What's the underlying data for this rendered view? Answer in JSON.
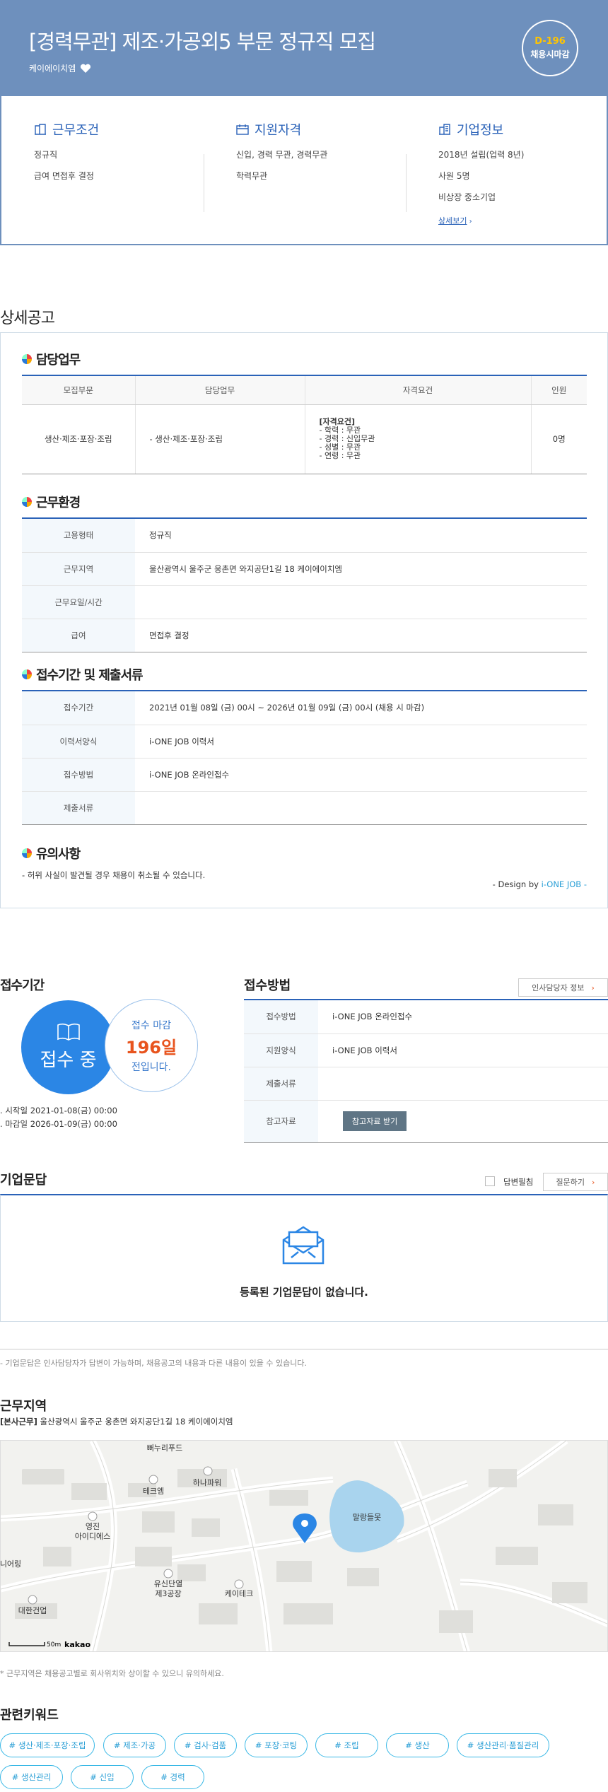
{
  "header": {
    "title": "[경력무관] 제조·가공외5 부문 정규직 모집",
    "company": "케이에이치엠",
    "dday": "D-196",
    "dday_sub": "채용시마감"
  },
  "summary": {
    "work": {
      "title": "근무조건",
      "lines": [
        "정규직",
        "급여 면접후 결정"
      ]
    },
    "qual": {
      "title": "지원자격",
      "lines": [
        "신입, 경력 무관, 경력무관",
        "학력무관"
      ]
    },
    "company": {
      "title": "기업정보",
      "lines": [
        "2018년 설립(업력 8년)",
        "사원 5명",
        "비상장 중소기업"
      ],
      "link": "상세보기"
    }
  },
  "detail": {
    "section_title": "상세공고",
    "duty": {
      "title": "담당업무",
      "headers": [
        "모집부문",
        "담당업무",
        "자격요건",
        "인원"
      ],
      "row": {
        "part": "생산·제조·포장·조립",
        "task": "- 생산·제조·포장·조립",
        "req_title": "[자격요건]",
        "req_lines": [
          "- 학력 : 무관",
          "- 경력 : 신입무관",
          "- 성별 : 무관",
          "- 연령 : 무관"
        ],
        "count": "0명"
      }
    },
    "env": {
      "title": "근무환경",
      "rows": [
        {
          "k": "고용형태",
          "v": "정규직"
        },
        {
          "k": "근무지역",
          "v": "울산광역시 울주군 웅촌면 와지공단1길 18 케이에이치엠"
        },
        {
          "k": "근무요일/시간",
          "v": ""
        },
        {
          "k": "급여",
          "v": "면접후 결정"
        }
      ]
    },
    "period": {
      "title": "접수기간 및 제출서류",
      "rows": [
        {
          "k": "접수기간",
          "v": "2021년 01월 08일 (금) 00시 ~ 2026년 01월 09일 (금) 00시 (채용 시 마감)"
        },
        {
          "k": "이력서양식",
          "v": "i-ONE JOB 이력서"
        },
        {
          "k": "접수방법",
          "v": "i-ONE JOB 온라인접수"
        },
        {
          "k": "제출서류",
          "v": ""
        }
      ]
    },
    "notice": {
      "title": "유의사항",
      "text": "- 허위 사실이 발견될 경우 채용이 취소될 수 있습니다."
    },
    "design_prefix": "- Design by ",
    "design_brand": "i-ONE JOB -"
  },
  "apply": {
    "period_title": "접수기간",
    "status": "접수 중",
    "deadline_label": "접수 마감",
    "days": "196일",
    "days_suffix": "전입니다.",
    "start": "시작일 2021-01-08(금) 00:00",
    "end": "마감일 2026-01-09(금) 00:00",
    "method_title": "접수방법",
    "hr_button": "인사담당자 정보",
    "rows": [
      {
        "k": "접수방법",
        "v": "i-ONE JOB 온라인접수"
      },
      {
        "k": "지원양식",
        "v": "i-ONE JOB 이력서"
      },
      {
        "k": "제출서류",
        "v": ""
      },
      {
        "k": "참고자료",
        "v": ""
      }
    ],
    "ref_button": "참고자료 받기"
  },
  "qa": {
    "title": "기업문답",
    "checkbox_label": "답변필침",
    "ask_button": "질문하기",
    "empty": "등록된 기업문답이 없습니다.",
    "note": "- 기업문답은 인사담당자가 답변이 가능하며, 채용공고의 내용과 다른 내용이 있을 수 있습니다."
  },
  "location": {
    "title": "근무지역",
    "tag": "[본사근무]",
    "address": "울산광역시 울주군 웅촌면 와지공단1길 18 케이에이치엠",
    "map_labels": {
      "road": "뻐누리푸드",
      "a": "하나파워",
      "b": "테크엠",
      "c": "영진\n아이디에스",
      "d": "말랑들못",
      "e": "유신단열\n제3공장",
      "f": "케이테크",
      "g": "대한건업",
      "h": "니어링",
      "scale": "50m",
      "brand": "kakao"
    },
    "note": "* 근무지역은 채용공고별로 회사위치와 상이할 수 있으니 유의하세요."
  },
  "keywords": {
    "title": "관련키워드",
    "items": [
      "# 생산·제조·포장·조립",
      "# 제조·가공",
      "# 검사·검품",
      "# 포장·코팅",
      "# 조립",
      "# 생산",
      "# 생산관리·품질관리",
      "# 생산관리",
      "# 신입",
      "# 경력"
    ]
  },
  "colors": {
    "header_bg": "#6e90bd",
    "accent": "#2a62b8",
    "apply_blue": "#2b86e5",
    "dday": "#ffc400",
    "days": "#e8541e"
  }
}
